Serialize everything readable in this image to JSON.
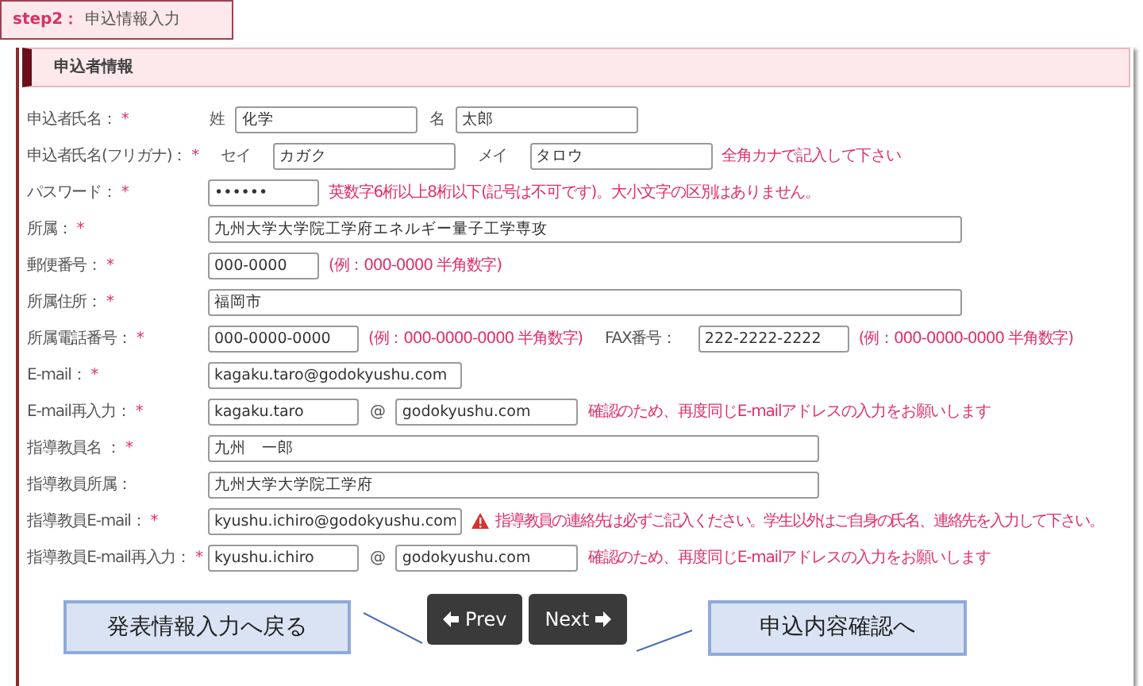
{
  "step": {
    "label": "step2：",
    "title": "申込情報入力"
  },
  "section": {
    "title": "申込者情報"
  },
  "rows": [
    {
      "label": "申込者氏名：",
      "marker": "*",
      "items": [
        {
          "kind": "text",
          "text": "姓"
        },
        {
          "kind": "input",
          "value": "化学"
        },
        {
          "kind": "text",
          "text": "名"
        },
        {
          "kind": "input",
          "value": "太郎"
        }
      ]
    },
    {
      "label": "申込者氏名(フリガナ)：",
      "marker": "*",
      "items": [
        {
          "kind": "text",
          "text": "セイ"
        },
        {
          "kind": "input",
          "value": "カガク"
        },
        {
          "kind": "text",
          "text": "メイ"
        },
        {
          "kind": "input",
          "value": "タロウ"
        },
        {
          "kind": "note",
          "text": "全角カナで記入して下さい"
        }
      ]
    },
    {
      "label": "パスワード：",
      "marker": "*",
      "items": [
        {
          "kind": "input",
          "value": "••••••"
        },
        {
          "kind": "note",
          "text": "英数字6桁以上8桁以下(記号は不可です)。大小文字の区別はありません。"
        }
      ]
    },
    {
      "label": "所属：",
      "marker": "*",
      "items": [
        {
          "kind": "input",
          "value": "九州大学大学院工学府エネルギー量子工学専攻"
        }
      ]
    },
    {
      "label": "郵便番号：",
      "marker": "*",
      "items": [
        {
          "kind": "input",
          "value": "000-0000"
        },
        {
          "kind": "note",
          "text": "(例：000-0000 半角数字)"
        }
      ]
    },
    {
      "label": "所属住所：",
      "marker": "*",
      "items": [
        {
          "kind": "input",
          "value": "福岡市"
        }
      ]
    },
    {
      "label": "所属電話番号：",
      "marker": "*",
      "items": [
        {
          "kind": "input",
          "value": "000-0000-0000"
        },
        {
          "kind": "note",
          "text": "(例：000-0000-0000 半角数字)"
        },
        {
          "kind": "text",
          "text": "FAX番号："
        },
        {
          "kind": "input",
          "value": "222-2222-2222"
        },
        {
          "kind": "note",
          "text": "(例：000-0000-0000 半角数字)"
        }
      ]
    },
    {
      "label": "E-mail：",
      "marker": "*",
      "items": [
        {
          "kind": "input",
          "value": "kagaku.taro@godokyushu.com"
        }
      ]
    },
    {
      "label": "E-mail再入力：",
      "marker": "*",
      "items": [
        {
          "kind": "input",
          "value": "kagaku.taro"
        },
        {
          "kind": "text",
          "text": "@"
        },
        {
          "kind": "input",
          "value": "godokyushu.com"
        },
        {
          "kind": "note",
          "text": "確認のため、再度同じE-mailアドレスの入力をお願いします"
        }
      ]
    },
    {
      "label": "指導教員名 ：",
      "marker": "*",
      "items": [
        {
          "kind": "input",
          "value": "九州　一郎"
        }
      ]
    },
    {
      "label": "指導教員所属：",
      "items": [
        {
          "kind": "input",
          "value": "九州大学大学院工学府"
        }
      ]
    },
    {
      "label": "指導教員E-mail：",
      "marker": "*",
      "items": [
        {
          "kind": "input",
          "value": "kyushu.ichiro@godokyushu.com"
        },
        {
          "kind": "warning",
          "text": "指導教員の連絡先は必ずご記入ください。学生以外はご自身の氏名、連絡先を入力して下さい。"
        }
      ]
    },
    {
      "label": "指導教員E-mail再入力：",
      "marker": "*",
      "items": [
        {
          "kind": "input",
          "value": "kyushu.ichiro"
        },
        {
          "kind": "text",
          "text": "@"
        },
        {
          "kind": "input",
          "value": "godokyushu.com"
        },
        {
          "kind": "note",
          "text": "確認のため、再度同じE-mailアドレスの入力をお願いします"
        }
      ]
    }
  ],
  "buttons": [
    {
      "kind": "prev",
      "label": "Prev"
    },
    {
      "kind": "next",
      "label": "Next"
    }
  ],
  "callouts": [
    {
      "kind": "prev",
      "text": "発表情報入力へ戻る"
    },
    {
      "kind": "next",
      "text": "申込内容確認へ"
    }
  ]
}
